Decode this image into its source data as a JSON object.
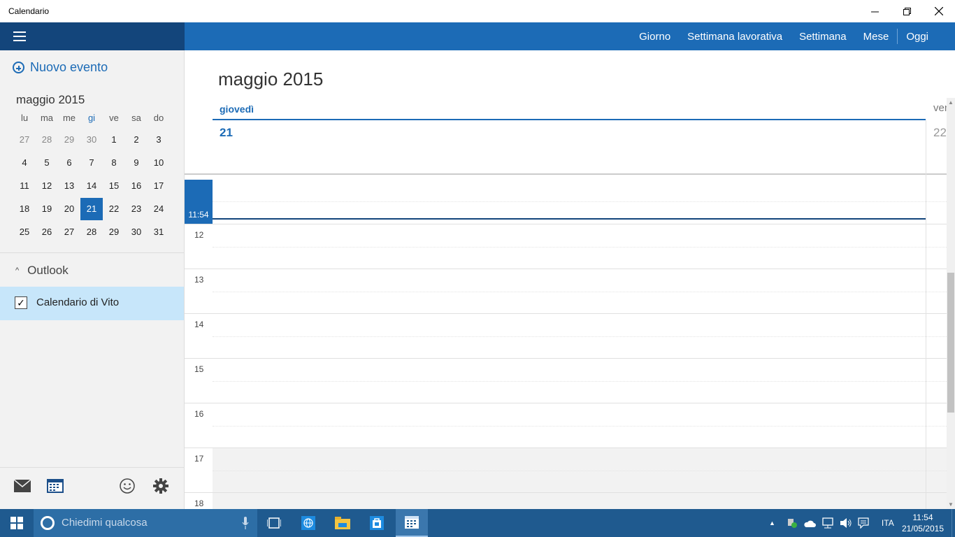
{
  "window": {
    "title": "Calendario"
  },
  "nav": {
    "day": "Giorno",
    "work_week": "Settimana lavorativa",
    "week": "Settimana",
    "month": "Mese",
    "today": "Oggi"
  },
  "sidebar": {
    "new_event": "Nuovo evento",
    "mini_month_title": "maggio 2015",
    "weekdays": [
      "lu",
      "ma",
      "me",
      "gi",
      "ve",
      "sa",
      "do"
    ],
    "weeks": [
      [
        "27",
        "28",
        "29",
        "30",
        "1",
        "2",
        "3"
      ],
      [
        "4",
        "5",
        "6",
        "7",
        "8",
        "9",
        "10"
      ],
      [
        "11",
        "12",
        "13",
        "14",
        "15",
        "16",
        "17"
      ],
      [
        "18",
        "19",
        "20",
        "21",
        "22",
        "23",
        "24"
      ],
      [
        "25",
        "26",
        "27",
        "28",
        "29",
        "30",
        "31"
      ]
    ],
    "selected_day": "21",
    "account": "Outlook",
    "calendar_name": "Calendario di Vito",
    "calendar_checked": true
  },
  "main": {
    "month_title": "maggio 2015",
    "day_name": "giovedì",
    "day_number": "21",
    "next_day_name": "ven",
    "next_day_number": "22",
    "current_time": "11:54",
    "hours": [
      "12",
      "13",
      "14",
      "15",
      "16",
      "17",
      "18"
    ]
  },
  "taskbar": {
    "search_placeholder": "Chiedimi qualcosa",
    "language": "ITA",
    "time": "11:54",
    "date": "21/05/2015"
  },
  "colors": {
    "accent": "#1c6bb6",
    "sidebar_header": "#13457b",
    "taskbar": "#1f5a8f",
    "selected_calendar": "#c7e6fa"
  }
}
